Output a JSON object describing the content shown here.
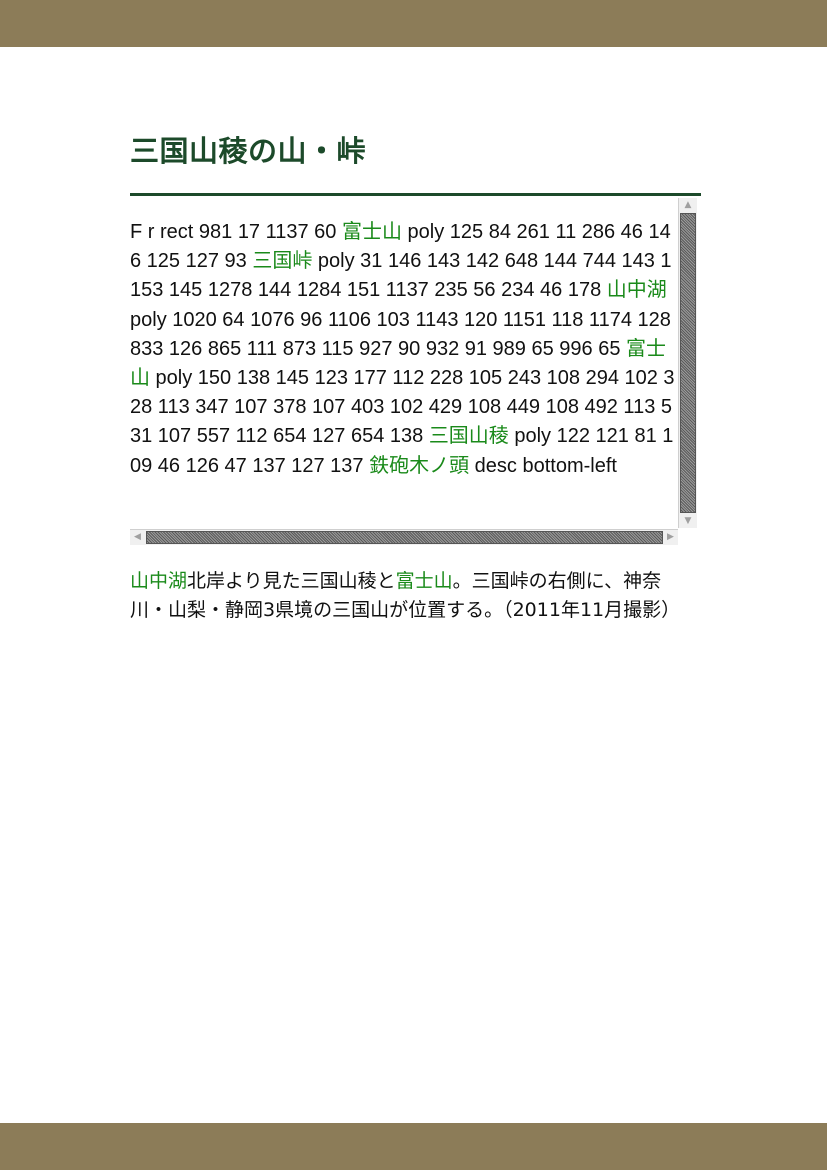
{
  "title": "三国山稜の山・峠",
  "imagemap_text": {
    "seg1": "F r rect 981 17 1137 60 ",
    "link1": "富士山",
    "seg2": " poly 125 84 261 11 286 46 146 125 127 93 ",
    "link2": "三国峠",
    "seg3": " poly 31 146 143 142 648 144 744 143 1153 145 1278 144 1284 151 1137 235 56 234 46 178 ",
    "link3": "山中湖",
    "seg4": " poly 1020 64 1076 96 1106 103 1143 120 1151 118 1174 128 833 126 865 111 873 115 927 90 932 91 989 65 996 65 ",
    "link4": "富士山",
    "seg5": " poly 150 138 145 123 177 112 228 105 243 108 294 102 328 113 347 107 378 107 403 102 429 108 449 108 492 113 531 107 557 112 654 127 654 138 ",
    "link5": "三国山稜",
    "seg6": " poly 122 121 81 109 46 126 47 137 127 137 ",
    "link6": "鉄砲木ノ頭",
    "seg7": " desc bottom-left"
  },
  "caption": {
    "link1": "山中湖",
    "text1": "北岸より見た三国山稜と",
    "link2": "富士山",
    "text2": "。三国峠の右側に、神奈川・山梨・静岡3県境の三国山が位置する。（2011年11月撮影）"
  },
  "colors": {
    "band": "#8c7c58",
    "title": "#1c4a2a",
    "link": "#1a8a1a"
  },
  "icons": {
    "scroll_up": "triangle-up",
    "scroll_down": "triangle-down",
    "scroll_left": "triangle-left",
    "scroll_right": "triangle-right"
  }
}
